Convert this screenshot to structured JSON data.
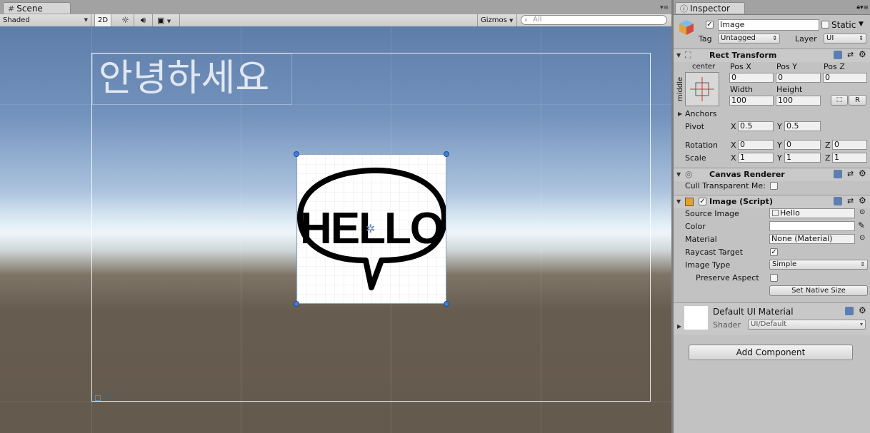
{
  "scene": {
    "tab_label": "Scene",
    "shading_mode": "Shaded",
    "mode_2d": "2D",
    "gizmos_label": "Gizmos",
    "search_placeholder": "All",
    "korean_text": "안녕하세요",
    "image_text": "HELLO"
  },
  "inspector": {
    "tab_label": "Inspector",
    "object_name": "Image",
    "static_label": "Static",
    "tag_label": "Tag",
    "tag_value": "Untagged",
    "layer_label": "Layer",
    "layer_value": "UI",
    "rect_transform": {
      "title": "Rect Transform",
      "anchor_h": "center",
      "anchor_v": "middle",
      "pos_x_label": "Pos X",
      "pos_x": "0",
      "pos_y_label": "Pos Y",
      "pos_y": "0",
      "pos_z_label": "Pos Z",
      "pos_z": "0",
      "width_label": "Width",
      "width": "100",
      "height_label": "Height",
      "height": "100",
      "r_button": "R",
      "anchors_label": "Anchors",
      "pivot_label": "Pivot",
      "pivot_x": "0.5",
      "pivot_y": "0.5",
      "rotation_label": "Rotation",
      "rot_x": "0",
      "rot_y": "0",
      "rot_z": "0",
      "scale_label": "Scale",
      "scale_x": "1",
      "scale_y": "1",
      "scale_z": "1",
      "x": "X",
      "y": "Y",
      "z": "Z"
    },
    "canvas_renderer": {
      "title": "Canvas Renderer",
      "cull_label": "Cull Transparent Me:"
    },
    "image_script": {
      "title": "Image (Script)",
      "source_image_label": "Source Image",
      "source_image_value": "Hello",
      "color_label": "Color",
      "material_label": "Material",
      "material_value": "None (Material)",
      "raycast_label": "Raycast Target",
      "image_type_label": "Image Type",
      "image_type_value": "Simple",
      "preserve_label": "Preserve Aspect",
      "native_size_button": "Set Native Size"
    },
    "material_preview": {
      "name": "Default UI Material",
      "shader_label": "Shader",
      "shader_value": "UI/Default"
    },
    "add_component": "Add Component"
  }
}
